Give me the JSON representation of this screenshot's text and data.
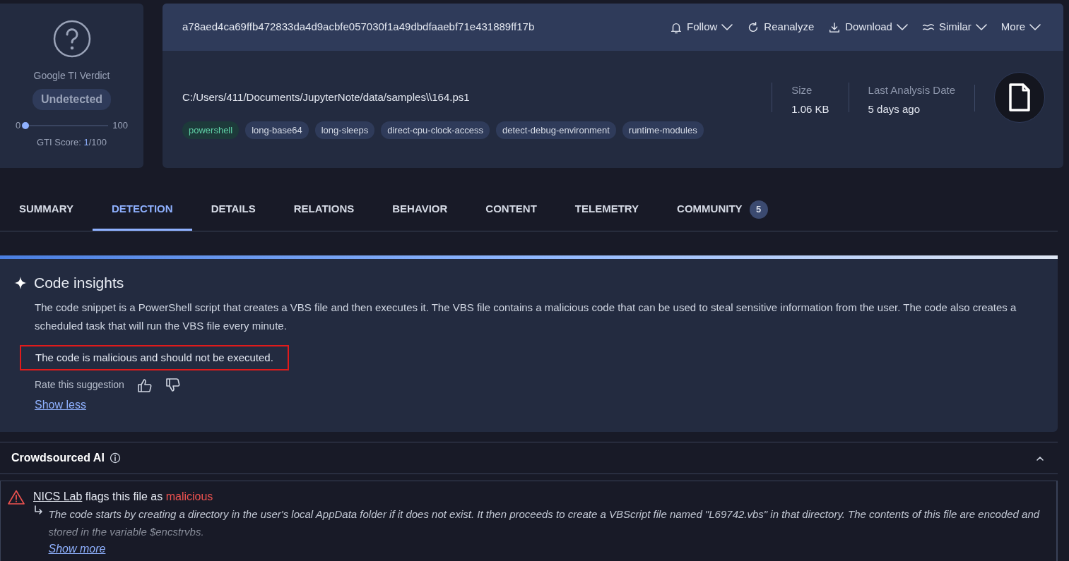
{
  "verdict": {
    "title": "Google TI Verdict",
    "badge": "Undetected",
    "min": "0",
    "max": "100",
    "level": 0.01,
    "score_label": "GTI Score:",
    "score": "1",
    "score_total": "/100"
  },
  "header": {
    "hash": "a78aed4ca69ffb472833da4d9acbfe057030f1a49dbdfaaebf71e431889ff17b",
    "actions": [
      {
        "label": "Follow",
        "kind": "bell",
        "dropdown": true
      },
      {
        "label": "Reanalyze",
        "kind": "refresh",
        "dropdown": false
      },
      {
        "label": "Download",
        "kind": "download",
        "dropdown": true
      },
      {
        "label": "Similar",
        "kind": "similar",
        "dropdown": true
      },
      {
        "label": "More",
        "kind": "none",
        "dropdown": true
      }
    ]
  },
  "file": {
    "path": "C:/Users/411/Documents/JupyterNote/data/samples\\\\164.ps1",
    "tags": [
      {
        "label": "powershell",
        "highlighted": true
      },
      {
        "label": "long-base64",
        "highlighted": false
      },
      {
        "label": "long-sleeps",
        "highlighted": false
      },
      {
        "label": "direct-cpu-clock-access",
        "highlighted": false
      },
      {
        "label": "detect-debug-environment",
        "highlighted": false
      },
      {
        "label": "runtime-modules",
        "highlighted": false
      }
    ],
    "stats": [
      {
        "label": "Size",
        "value": "1.06 KB"
      },
      {
        "label": "Last Analysis Date",
        "value": "5 days ago"
      }
    ]
  },
  "tabs": [
    {
      "label": "SUMMARY",
      "selected": false
    },
    {
      "label": "DETECTION",
      "selected": true
    },
    {
      "label": "DETAILS",
      "selected": false
    },
    {
      "label": "RELATIONS",
      "selected": false
    },
    {
      "label": "BEHAVIOR",
      "selected": false
    },
    {
      "label": "CONTENT",
      "selected": false
    },
    {
      "label": "TELEMETRY",
      "selected": false
    },
    {
      "label": "COMMUNITY",
      "selected": false,
      "count": "5"
    }
  ],
  "code_insights": {
    "title": "Code insights",
    "text": "The code snippet is a PowerShell script that creates a VBS file and then executes it. The VBS file contains a malicious code that can be used to steal sensitive information from the user. The code also creates a scheduled task that will run the VBS file every minute.",
    "conclusion": "The code is malicious and should not be executed.",
    "conclusion_outlined": true,
    "rate_label": "Rate this suggestion",
    "toggle": "Show less"
  },
  "crowdsourced_ai": {
    "title": "Crowdsourced AI",
    "expanded": true,
    "entries": [
      {
        "source": "NICS Lab",
        "phrase": "flags this file as",
        "verdict": "malicious",
        "text": "The code starts by creating a directory in the user's local AppData folder if it does not exist. It then proceeds to create a VBScript file named \"L69742.vbs\" in that directory. The contents of this file are encoded and stored in the variable $encstrvbs.",
        "toggle": "Show more"
      }
    ]
  }
}
